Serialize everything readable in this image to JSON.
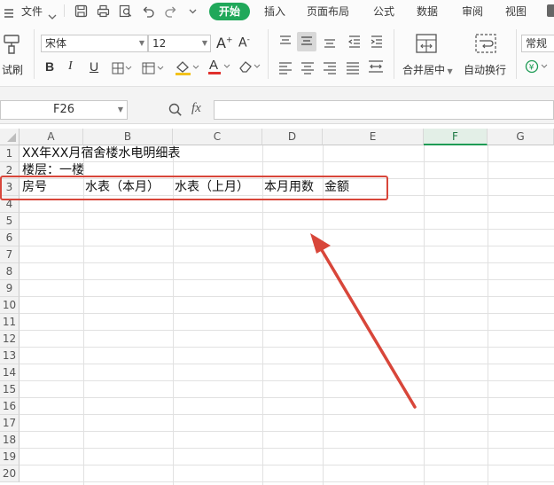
{
  "menubar": {
    "file_label": "文件",
    "tabs": [
      "开始",
      "插入",
      "页面布局",
      "公式",
      "数据",
      "审阅",
      "视图"
    ],
    "active_tab": "开始"
  },
  "ribbon": {
    "font_name": "宋体",
    "font_size": "12",
    "format_painter_label": "试刷",
    "merge_center_label": "合并居中",
    "wrap_text_label": "自动换行",
    "number_format": "常规"
  },
  "formula_bar": {
    "name_box": "F26",
    "fx_label": "fx",
    "formula": ""
  },
  "sheet": {
    "columns": [
      "A",
      "B",
      "C",
      "D",
      "E",
      "F",
      "G"
    ],
    "selected_column": "F",
    "rows": [
      "1",
      "2",
      "3",
      "4",
      "5",
      "6",
      "7",
      "8",
      "9",
      "10",
      "11",
      "12",
      "13",
      "14",
      "15",
      "16",
      "17",
      "18",
      "19",
      "20"
    ],
    "cells": {
      "A1": "XX年XX月宿舍楼水电明细表",
      "A2": "楼层：一楼",
      "A3": "房号",
      "B3": "水表（本月）",
      "C3": "水表（上月）",
      "D3": "本月用数",
      "E3": "金额"
    }
  },
  "annotation": {
    "box_color": "#d8463a",
    "arrow_color": "#d8463a"
  }
}
